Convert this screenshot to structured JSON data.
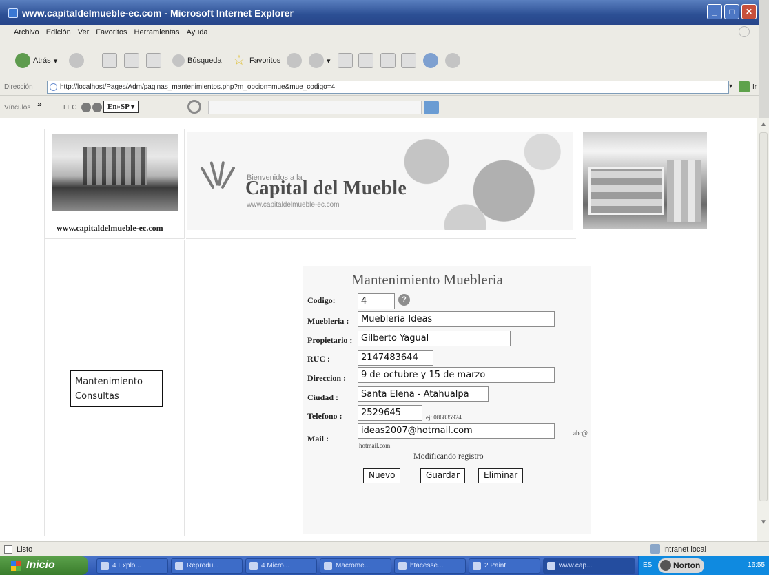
{
  "window": {
    "title": "www.capitaldelmueble-ec.com - Microsoft Internet Explorer"
  },
  "menu": [
    "Archivo",
    "Edición",
    "Ver",
    "Favoritos",
    "Herramientas",
    "Ayuda"
  ],
  "toolbar": {
    "back": "Atrás",
    "search": "Búsqueda",
    "favorites": "Favoritos"
  },
  "address": {
    "label": "Dirección",
    "url": "http://localhost/Pages/Adm/paginas_mantenimientos.php?m_opcion=mue&mue_codigo=4",
    "go": "Ir"
  },
  "links": {
    "label": "Vínculos",
    "lec": "LEC",
    "translate": "En»SP ▾"
  },
  "site": {
    "url_caption": "www.capitaldelmueble-ec.com",
    "banner_welcome": "Bienvenidos a la",
    "banner_title": "Capital del Mueble",
    "banner_url": "www.capitaldelmueble-ec.com"
  },
  "side_menu": [
    "Mantenimiento",
    "Consultas"
  ],
  "form": {
    "title": "Mantenimiento Muebleria",
    "fields": {
      "codigo": {
        "label": "Codigo:",
        "value": "4"
      },
      "muebleria": {
        "label": "Muebleria :",
        "value": "Muebleria Ideas"
      },
      "propietario": {
        "label": "Propietario :",
        "value": "Gilberto Yagual"
      },
      "ruc": {
        "label": "RUC :",
        "value": "2147483644"
      },
      "direccion": {
        "label": "Direccion :",
        "value": "9 de octubre y 15 de marzo"
      },
      "ciudad": {
        "label": "Ciudad :",
        "value": "Santa Elena - Atahualpa"
      },
      "telefono": {
        "label": "Telefono :",
        "value": "2529645",
        "hint": "ej: 086835924"
      },
      "mail": {
        "label": "Mail :",
        "value": "ideas2007@hotmail.com",
        "hint": "abc@",
        "hint2": "hotmail.com"
      }
    },
    "status": "Modificando registro",
    "buttons": {
      "new": "Nuevo",
      "save": "Guardar",
      "delete": "Eliminar"
    }
  },
  "statusbar": {
    "text": "Listo",
    "zone": "Intranet local"
  },
  "taskbar": {
    "start": "Inicio",
    "tasks": [
      "4 Explo...",
      "Reprodu...",
      "4 Micro...",
      "Macrome...",
      "htacesse...",
      "2 Paint",
      "www.cap..."
    ],
    "lang": "ES",
    "norton": "Norton",
    "clock": "16:55"
  }
}
